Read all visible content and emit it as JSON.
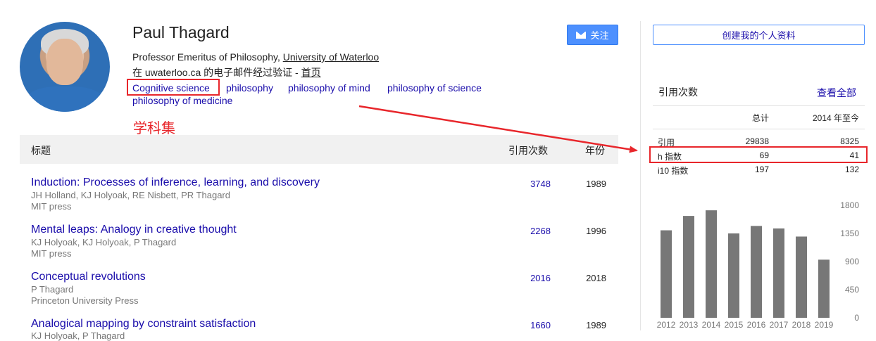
{
  "profile": {
    "name": "Paul Thagard",
    "affiliation_prefix": "Professor Emeritus of Philosophy, ",
    "affiliation_link": "University of Waterloo",
    "verified_text": "在 uwaterloo.ca 的电子邮件经过验证 - ",
    "homepage_link": "首页",
    "tags": [
      "Cognitive science",
      "philosophy",
      "philosophy of mind",
      "philosophy of science",
      "philosophy of medicine"
    ],
    "annotation": "学科集",
    "follow_label": "关注"
  },
  "table": {
    "col_title": "标题",
    "col_cited": "引用次数",
    "col_year": "年份",
    "rows": [
      {
        "title": "Induction: Processes of inference, learning, and discovery",
        "authors": "JH Holland, KJ Holyoak, RE Nisbett, PR Thagard",
        "venue": "MIT press",
        "cited": "3748",
        "year": "1989"
      },
      {
        "title": "Mental leaps: Analogy in creative thought",
        "authors": "KJ Holyoak, KJ Holyoak, P Thagard",
        "venue": "MIT press",
        "cited": "2268",
        "year": "1996"
      },
      {
        "title": "Conceptual revolutions",
        "authors": "P Thagard",
        "venue": "Princeton University Press",
        "cited": "2016",
        "year": "2018"
      },
      {
        "title": "Analogical mapping by constraint satisfaction",
        "authors": "KJ Holyoak, P Thagard",
        "venue": "",
        "cited": "1660",
        "year": "1989"
      }
    ]
  },
  "sidebar": {
    "create_profile": "创建我的个人资料",
    "stats_title": "引用次数",
    "view_all": "查看全部",
    "col_total": "总计",
    "col_since": "2014 年至今",
    "stats": [
      {
        "label": "引用",
        "total": "29838",
        "since": "8325"
      },
      {
        "label": "h 指数",
        "total": "69",
        "since": "41"
      },
      {
        "label": "i10 指数",
        "total": "197",
        "since": "132"
      }
    ]
  },
  "colors": {
    "annotation_red": "#e8262b",
    "link_blue": "#1a0dab",
    "button_blue": "#4d90fe",
    "bar_gray": "#777777"
  },
  "chart_data": {
    "type": "bar",
    "categories": [
      "2012",
      "2013",
      "2014",
      "2015",
      "2016",
      "2017",
      "2018",
      "2019"
    ],
    "values": [
      1400,
      1630,
      1720,
      1350,
      1470,
      1430,
      1300,
      930
    ],
    "ylim": [
      0,
      1800
    ],
    "yticks": [
      "1800",
      "1350",
      "900",
      "450",
      "0"
    ],
    "ytick_values": [
      1800,
      1350,
      900,
      450,
      0
    ]
  }
}
